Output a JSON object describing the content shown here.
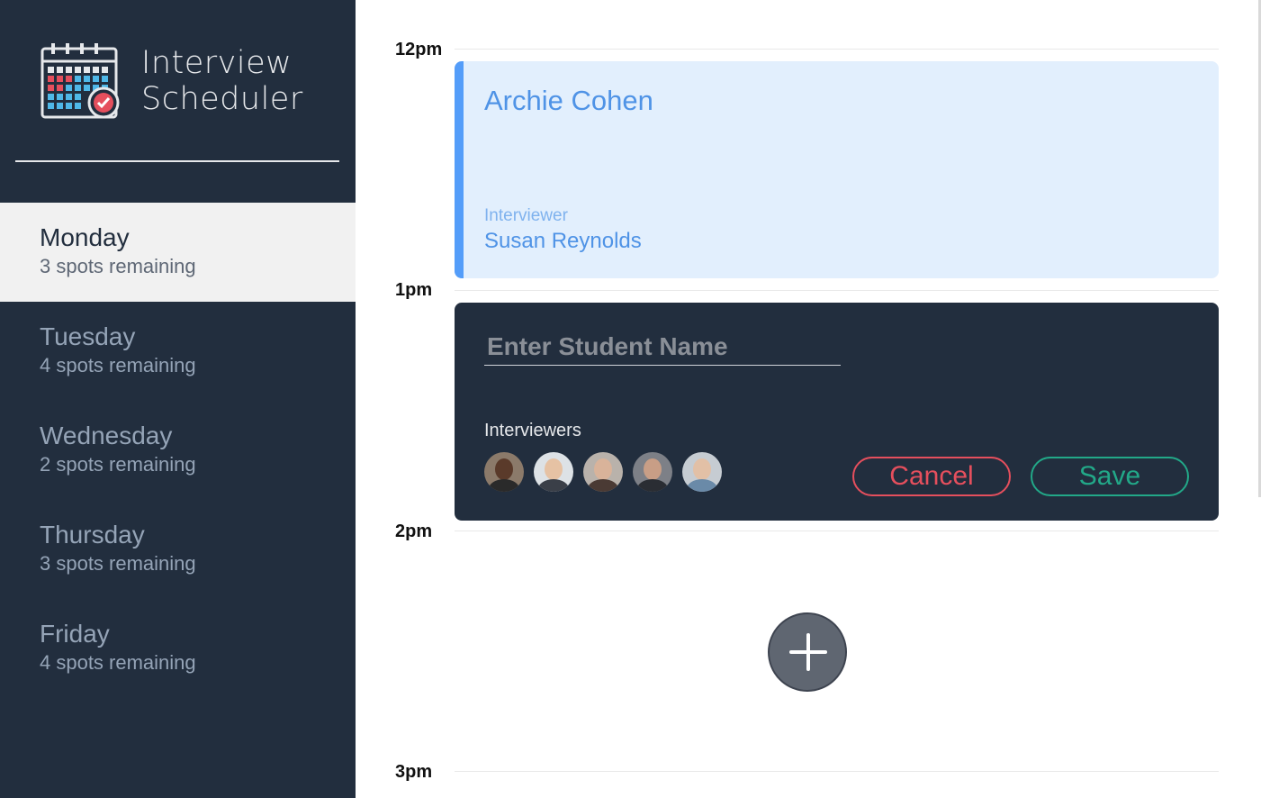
{
  "brand": {
    "title_line1": "Interview",
    "title_line2": "Scheduler",
    "logo_icon": "calendar-check-icon"
  },
  "sidebar": {
    "days": [
      {
        "name": "Monday",
        "spots": "3 spots remaining",
        "selected": true
      },
      {
        "name": "Tuesday",
        "spots": "4 spots remaining",
        "selected": false
      },
      {
        "name": "Wednesday",
        "spots": "2 spots remaining",
        "selected": false
      },
      {
        "name": "Thursday",
        "spots": "3 spots remaining",
        "selected": false
      },
      {
        "name": "Friday",
        "spots": "4 spots remaining",
        "selected": false
      }
    ]
  },
  "schedule": {
    "times": [
      "12pm",
      "1pm",
      "2pm",
      "3pm"
    ],
    "appointment": {
      "student": "Archie Cohen",
      "interviewer_label": "Interviewer",
      "interviewer": "Susan Reynolds"
    },
    "form": {
      "student_value": "",
      "student_placeholder": "Enter Student Name",
      "interviewers_label": "Interviewers",
      "avatar_count": 5,
      "cancel_label": "Cancel",
      "save_label": "Save"
    },
    "add_icon": "plus-icon"
  },
  "colors": {
    "sidebar_bg": "#222e3e",
    "selected_day_bg": "#f1f1f1",
    "appointment_bg": "#e2effd",
    "appointment_accent": "#549df9",
    "cancel": "#e54f5d",
    "save": "#22a888"
  }
}
